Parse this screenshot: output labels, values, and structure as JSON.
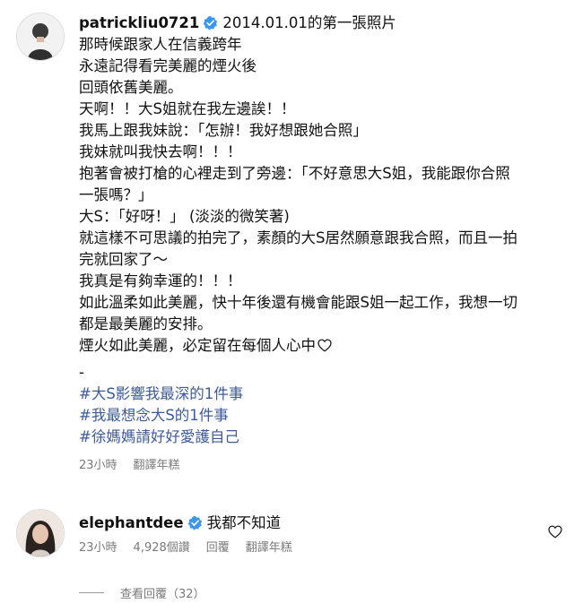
{
  "post": {
    "username": "patrickliu0721",
    "title": "2014.01.01的第一張照片",
    "lines": [
      "那時候跟家人在信義跨年",
      "永遠記得看完美麗的煙火後",
      "回頭依舊美麗。",
      "天啊！！大S姐就在我左邊誒！！",
      "我馬上跟我妹說：「怎辦！我好想跟她合照」",
      "我妹就叫我快去啊！！！",
      "抱著會被打槍的心裡走到了旁邊：「不好意思大S姐，我能跟你合照",
      "一張嗎？」",
      "大S：「好呀！」 (淡淡的微笑著)",
      "就這樣不可思議的拍完了，素顏的大S居然願意跟我合照，而且一拍",
      "完就回家了～",
      "我真是有夠幸運的！！！",
      "如此溫柔如此美麗，快十年後還有機會能跟S姐一起工作，我想一切",
      "都是最美麗的安排。",
      "煙火如此美麗，必定留在每個人心中"
    ],
    "separator": "-",
    "hashtags": [
      "#大S影響我最深的1件事",
      "#我最想念大S的1件事",
      "#徐媽媽請好好愛護自己"
    ],
    "time": "23小時",
    "translate": "翻譯年糕"
  },
  "reply": {
    "username": "elephantdee",
    "text": "我都不知道",
    "time": "23小時",
    "likes": "4,928個讚",
    "reply_label": "回覆",
    "translate": "翻譯年糕"
  },
  "view_replies": "查看回覆（32）",
  "icons": {
    "verified": "verified-badge-icon",
    "heart": "heart-outline-icon",
    "like": "heart-outline-icon"
  },
  "colors": {
    "verified": "#3897f0",
    "hashtag": "#3d5a99",
    "muted": "#7a7a7a"
  }
}
